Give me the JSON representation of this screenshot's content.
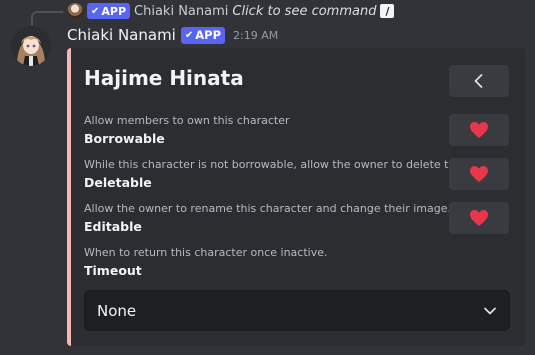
{
  "reply": {
    "badge": "APP",
    "author": "Chiaki Nanami",
    "command_text": "Click to see command",
    "command_icon": "/"
  },
  "message": {
    "author": "Chiaki Nanami",
    "badge": "APP",
    "timestamp": "2:19 AM",
    "accent_color": "#f5b8b8"
  },
  "embed": {
    "title": "Hajime Hinata",
    "back_icon": "chevron-left-icon",
    "fields": [
      {
        "description": "Allow members to own this character",
        "name": "Borrowable",
        "icon": "heart-icon"
      },
      {
        "description": "While this character is not borrowable, allow the owner to delete this.",
        "name": "Deletable",
        "icon": "heart-icon"
      },
      {
        "description": "Allow the owner to rename this character and change their image.",
        "name": "Editable",
        "icon": "heart-icon"
      },
      {
        "description": "When to return this character once inactive.",
        "name": "Timeout"
      }
    ],
    "select": {
      "value": "None",
      "icon": "chevron-down-icon"
    }
  },
  "colors": {
    "heart": "#e8374a",
    "badge": "#5865f2",
    "background": "#313338",
    "embed": "#2b2d31"
  }
}
